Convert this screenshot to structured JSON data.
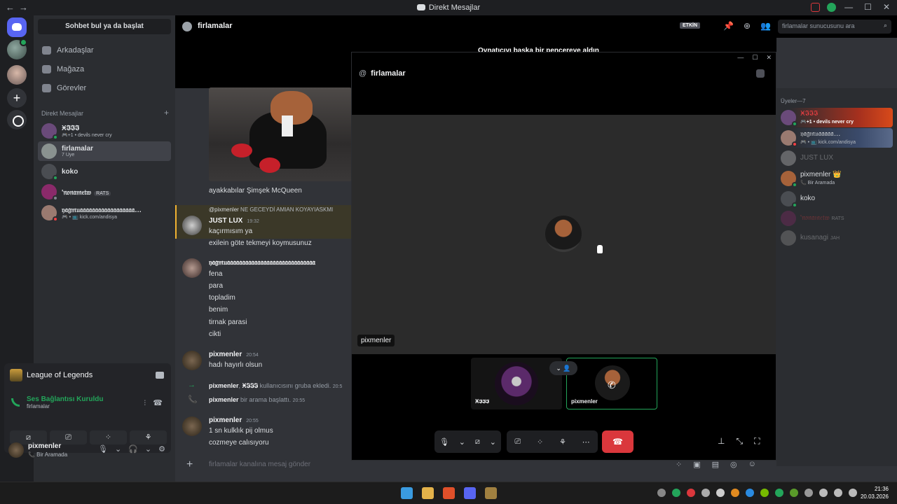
{
  "window": {
    "title": "Direkt Mesajlar"
  },
  "sidebar": {
    "search_label": "Sohbet bul ya da başlat",
    "nav": [
      {
        "label": "Arkadaşlar",
        "icon": "friends-icon"
      },
      {
        "label": "Mağaza",
        "icon": "store-icon"
      },
      {
        "label": "Görevler",
        "icon": "quests-icon"
      }
    ],
    "dm_header": "Direkt Mesajlar",
    "dm_add": "+",
    "dms": [
      {
        "name": "Ӿ𝕴𝕴𝕴",
        "sub": "🎮+1 • devils never cry",
        "tag": "",
        "status": "online",
        "color": "#6a4a7a"
      },
      {
        "name": "firlamalar",
        "sub": "7 Üye",
        "tag": "",
        "status": "",
        "color": "#8a9290"
      },
      {
        "name": "koko",
        "sub": "",
        "tag": "",
        "status": "online",
        "color": "#4a4d52"
      },
      {
        "name": "'𝔫𝔬𝔫𝔞𝔪𝔢𝔱𝔴",
        "sub": "",
        "tag": "RATS",
        "status": "idle",
        "color": "#8a2a6a"
      },
      {
        "name": "𝔶𝔞𝔤𝔪𝔲𝔞𝔞𝔞𝔞𝔞𝔞𝔞𝔞𝔞𝔞𝔞𝔞𝔞𝔞𝔞𝔞𝔞𝔞…",
        "sub": "🎮 • 📺 kick.com/andisya",
        "tag": "",
        "status": "dnd",
        "color": "#9a7a70"
      }
    ],
    "activity": {
      "game": "League of Legends",
      "voice_status": "Ses Bağlantısı Kuruldu",
      "voice_channel": "firlamalar",
      "buttons": [
        "⧄",
        "⎚",
        "⁘",
        "⚘"
      ]
    },
    "user": {
      "name": "pixmenler",
      "status": "📞 Bir Aramada",
      "controls": [
        "🎙",
        "⌄",
        "🎧",
        "⌄",
        "⚙"
      ]
    }
  },
  "chat": {
    "title": "firlamalar",
    "etkin_badge": "ETKİN",
    "search_placeholder": "firlamalar sunucusunu ara",
    "popout_notice": "Oynatıcıyı başka bir pencereye aldın",
    "image_caption": "ayakkabılar Şimşek McQueen",
    "reply_author": "@pixmenler",
    "reply_text": "NE GECEYDİ AMIAN KOYAYIASKMI",
    "messages": [
      {
        "author": "JUST LUX",
        "time": "19:32",
        "lines": [
          "kaçırmısım ya",
          "exilein göte tekmeyi koymusunuz"
        ]
      },
      {
        "author": "𝔶𝔞𝔤𝔪𝔲𝔞𝔞𝔞𝔞𝔞𝔞𝔞𝔞𝔞𝔞𝔞𝔞𝔞𝔞𝔞𝔞𝔞𝔞𝔞𝔞𝔞𝔞𝔞𝔞𝔞𝔞𝔞𝔞𝔞",
        "time": "",
        "lines": [
          "fena",
          "para",
          "topladim",
          "benim",
          "tirnak parasi",
          "cikti"
        ]
      },
      {
        "author": "pixmenler",
        "time": "20:54",
        "lines": [
          "hadı hayırlı olsun"
        ]
      },
      {
        "author": "pixmenler",
        "time": "20:55",
        "lines": [
          "1 sn kulklık pij olmus",
          "cozmeye calısıyoru"
        ]
      }
    ],
    "system": [
      {
        "actor": "pixmenler",
        "target": "Ӿ𝕴𝕴𝕴",
        "text": "kullanıcısını gruba ekledi.",
        "time": "20:5"
      },
      {
        "actor": "pixmenler",
        "target": "",
        "text": "bir arama başlattı.",
        "time": "20:55"
      }
    ],
    "input_placeholder": "firlamalar kanalına mesaj gönder"
  },
  "members": {
    "header": "Üyeler—7",
    "list": [
      {
        "name": "Ӿ𝕴𝕴𝕴",
        "sub": "🎮+1 • devils never cry",
        "dim": false,
        "banner": "#a5301e"
      },
      {
        "name": "𝔶𝔞𝔤𝔪𝔲𝔞𝔞𝔞𝔞𝔞…",
        "sub": "🎮 • 📺 kick.com/andisya",
        "dim": false,
        "banner": "#3a4a6a"
      },
      {
        "name": "JUST LUX",
        "sub": "",
        "dim": true,
        "banner": ""
      },
      {
        "name": "pixmenler 👑",
        "sub": "📞 Bir Aramada",
        "dim": false,
        "banner": ""
      },
      {
        "name": "koko",
        "sub": "",
        "dim": false,
        "banner": ""
      },
      {
        "name": "'𝔫𝔬𝔫𝔞𝔪𝔢𝔱𝔴",
        "sub": "RATS",
        "dim": true,
        "banner": ""
      },
      {
        "name": "kusanagi",
        "sub": "JAH",
        "dim": true,
        "banner": ""
      }
    ]
  },
  "call": {
    "title": "firlamalar",
    "speaker_name": "pixmenler",
    "tiles": [
      {
        "name": "Ӿ𝕴𝕴𝕴"
      },
      {
        "name": "pixmenler"
      }
    ]
  },
  "taskbar": {
    "time": "21:36",
    "date": "20.03.2026"
  }
}
